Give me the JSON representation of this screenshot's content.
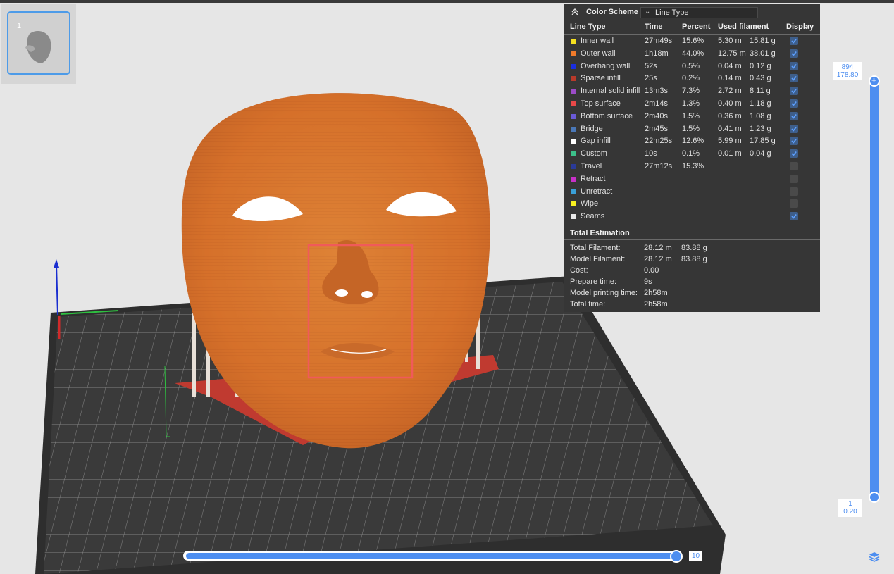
{
  "thumbnail": {
    "plate_number": "1"
  },
  "color_scheme": {
    "title": "Color Scheme",
    "selected": "Line Type"
  },
  "table": {
    "headers": {
      "line_type": "Line Type",
      "time": "Time",
      "percent": "Percent",
      "used_filament": "Used filament",
      "display": "Display"
    },
    "rows": [
      {
        "name": "Inner wall",
        "color": "#f5e020",
        "time": "27m49s",
        "percent": "15.6%",
        "length": "5.30 m",
        "weight": "15.81 g",
        "display": true
      },
      {
        "name": "Outer wall",
        "color": "#f07a2a",
        "time": "1h18m",
        "percent": "44.0%",
        "length": "12.75 m",
        "weight": "38.01 g",
        "display": true
      },
      {
        "name": "Overhang wall",
        "color": "#1a2ee0",
        "time": "52s",
        "percent": "0.5%",
        "length": "0.04 m",
        "weight": "0.12 g",
        "display": true
      },
      {
        "name": "Sparse infill",
        "color": "#b83a2a",
        "time": "25s",
        "percent": "0.2%",
        "length": "0.14 m",
        "weight": "0.43 g",
        "display": true
      },
      {
        "name": "Internal solid infill",
        "color": "#9c4cc8",
        "time": "13m3s",
        "percent": "7.3%",
        "length": "2.72 m",
        "weight": "8.11 g",
        "display": true
      },
      {
        "name": "Top surface",
        "color": "#e84848",
        "time": "2m14s",
        "percent": "1.3%",
        "length": "0.40 m",
        "weight": "1.18 g",
        "display": true
      },
      {
        "name": "Bottom surface",
        "color": "#6a5ad8",
        "time": "2m40s",
        "percent": "1.5%",
        "length": "0.36 m",
        "weight": "1.08 g",
        "display": true
      },
      {
        "name": "Bridge",
        "color": "#4a78b8",
        "time": "2m45s",
        "percent": "1.5%",
        "length": "0.41 m",
        "weight": "1.23 g",
        "display": true
      },
      {
        "name": "Gap infill",
        "color": "#ffffff",
        "time": "22m25s",
        "percent": "12.6%",
        "length": "5.99 m",
        "weight": "17.85 g",
        "display": true
      },
      {
        "name": "Custom",
        "color": "#3cc08a",
        "time": "10s",
        "percent": "0.1%",
        "length": "0.01 m",
        "weight": "0.04 g",
        "display": true
      },
      {
        "name": "Travel",
        "color": "#2a3a98",
        "time": "27m12s",
        "percent": "15.3%",
        "length": "",
        "weight": "",
        "display": false
      },
      {
        "name": "Retract",
        "color": "#c830c8",
        "time": "",
        "percent": "",
        "length": "",
        "weight": "",
        "display": false
      },
      {
        "name": "Unretract",
        "color": "#3aa0d8",
        "time": "",
        "percent": "",
        "length": "",
        "weight": "",
        "display": false
      },
      {
        "name": "Wipe",
        "color": "#f8f020",
        "time": "",
        "percent": "",
        "length": "",
        "weight": "",
        "display": false
      },
      {
        "name": "Seams",
        "color": "#e8e8e8",
        "time": "",
        "percent": "",
        "length": "",
        "weight": "",
        "display": true
      }
    ]
  },
  "totals": {
    "title": "Total Estimation",
    "rows": [
      {
        "label": "Total Filament:",
        "value": "28.12 m",
        "value2": "83.88 g"
      },
      {
        "label": "Model Filament:",
        "value": "28.12 m",
        "value2": "83.88 g"
      },
      {
        "label": "Cost:",
        "value": "0.00",
        "value2": ""
      },
      {
        "label": "Prepare time:",
        "value": "9s",
        "value2": ""
      },
      {
        "label": "Model printing time:",
        "value": "2h58m",
        "value2": ""
      },
      {
        "label": "Total time:",
        "value": "2h58m",
        "value2": ""
      }
    ]
  },
  "layer_slider": {
    "top_layer": "894",
    "top_height": "178.80",
    "bottom_layer": "1",
    "bottom_height": "0.20"
  },
  "move_slider": {
    "value": "10"
  },
  "colors": {
    "accent": "#4d8ef0",
    "model": "#d9732e",
    "panel_bg": "#363636",
    "plate": "#3a3a3a",
    "highlight_box": "#f05a5a"
  }
}
